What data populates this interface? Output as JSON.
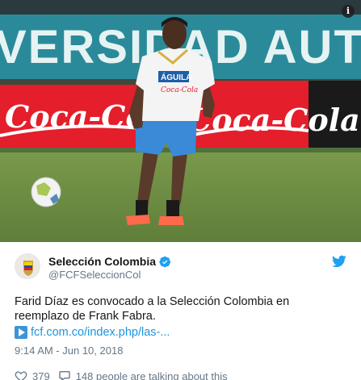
{
  "photo": {
    "banner_text": "VERSIDAD AUTON",
    "board_left_text": "Coca-Cola",
    "board_right_text": "Coca-Cola",
    "jersey_sponsor": "ÁGUILA",
    "jersey_sub": "Coca-Cola",
    "info_glyph": "i"
  },
  "tweet": {
    "display_name": "Selección Colombia",
    "handle": "@FCFSeleccionCol",
    "text": "Farid Díaz es convocado a la Selección Colombia en reemplazo de Frank Fabra.",
    "link": "fcf.com.co/index.php/las-...",
    "timestamp": "9:14 AM - Jun 10, 2018",
    "like_count": "379",
    "talking": "148 people are talking about this"
  },
  "icons": {
    "verified": "verified-badge-icon",
    "twitter": "twitter-bird-icon",
    "link": "link-arrow-icon",
    "like": "heart-icon",
    "reply": "speech-bubble-icon",
    "info": "info-icon"
  },
  "colors": {
    "twitter_blue": "#1da1f2",
    "link_blue": "#1b95e0",
    "muted": "#657786",
    "banner_teal": "#2a8a9a",
    "coca_red": "#e41e2b"
  }
}
